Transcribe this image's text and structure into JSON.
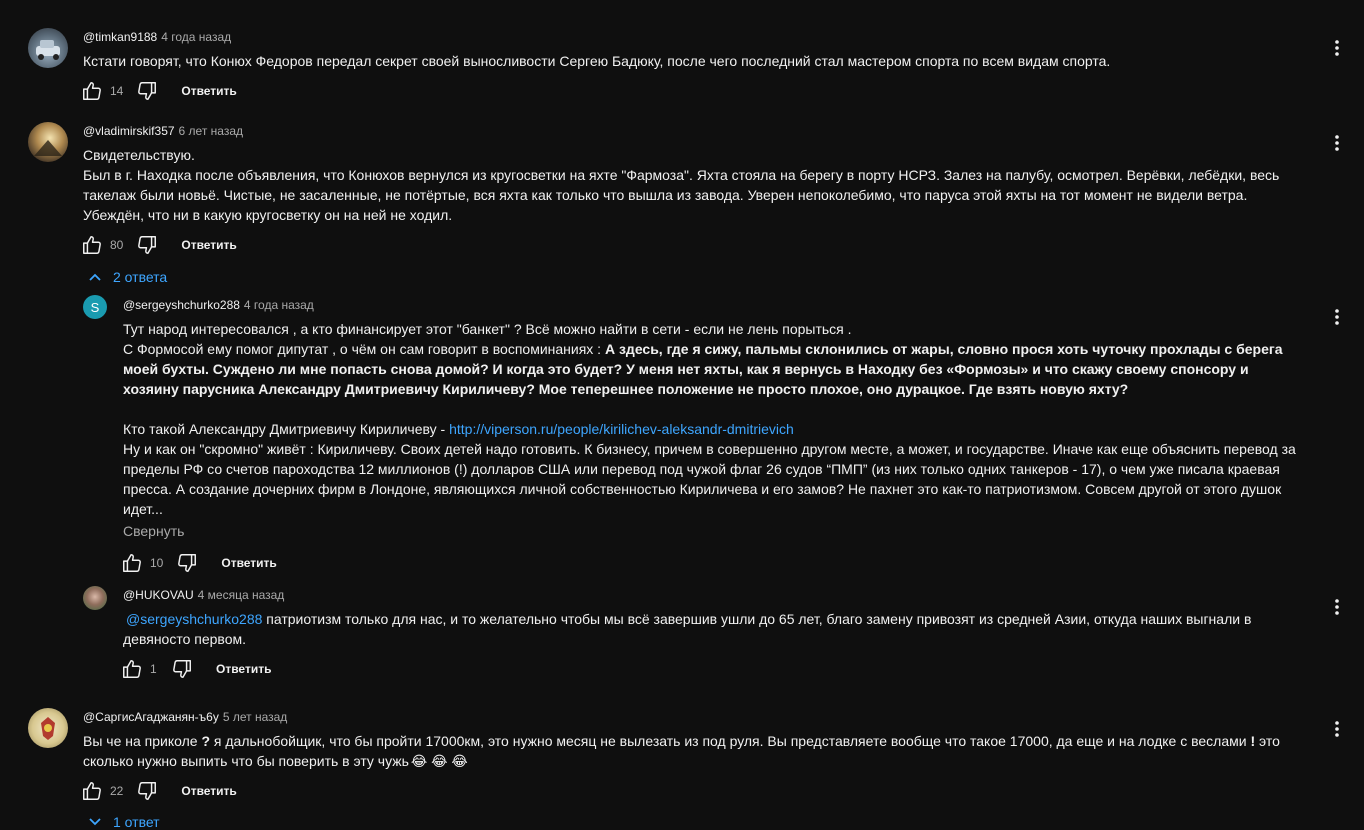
{
  "comments": [
    {
      "author": "@timkan9188",
      "time": "4 года назад",
      "text": "Кстати говорят, что Конюх Федоров передал секрет своей выносливости Сергею Бадюку, после чего последний стал мастером спорта по всем видам спорта.",
      "likes": "14",
      "reply_label": "Ответить"
    },
    {
      "author": "@vladimirskif357",
      "time": "6 лет назад",
      "text_lines": [
        "Свидетельствую.",
        "Был в г. Находка после объявления, что Конюхов вернулся из кругосветки на яхте \"Фармоза\". Яхта стояла на берегу в порту  НСРЗ. Залез на палубу, осмотрел. Верёвки, лебёдки, весь такелаж были новьё. Чистые, не засаленные, не потёртые, вся яхта как только что вышла из завода. Уверен непоколебимо, что паруса этой яхты на тот момент не видели ветра. Убеждён, что ни в какую кругосветку он на ней не ходил."
      ],
      "likes": "80",
      "reply_label": "Ответить",
      "replies_toggle": "2 ответа",
      "replies": [
        {
          "author": "@sergeyshchurko288",
          "time": "4 года назад",
          "avatar_letter": "S",
          "line1": "Тут народ интересовался , а кто финансирует этот \"банкет\" ? Всё можно найти в сети - если не лень порыться .",
          "line2_plain": "С Формосой ему помог дипутат , о чём он сам говорит в воспоминаниях : ",
          "line2_bold": "А здесь, где я сижу, пальмы склонились от жары, словно прося хоть чуточку прохлады с берега моей бухты. Суждено ли мне попасть снова домой? И когда это будет? У меня нет яхты, как я вернусь в Находку без «Формозы» и что скажу своему спонсору и хозяину парусника Александру Дмитриевичу Кириличеву? Мое теперешнее положение не просто плохое, оно дурацкое. Где взять новую яхту?",
          "line3_plain": "Кто такой Александру Дмитриевичу Кириличеву  - ",
          "line3_link": "http://viperson.ru/people/kirilichev-aleksandr-dmitrievich",
          "line4": "Ну и как он \"скромно\" живёт : Кириличеву. Своих детей надо готовить. К бизнесу, причем в совершенно другом месте, а может, и государстве. Иначе как еще объяснить перевод за пределы РФ со счетов пароходства 12 миллионов (!) долларов США или перевод под чужой флаг 26 судов “ПМП” (из них только одних танкеров - 17), о чем уже писала краевая пресса. А создание дочерних фирм в Лондоне, являющихся личной собственностью Кириличева и его замов? Не пахнет это как-то патриотизмом. Совсем другой от этого душок идет...",
          "collapse_label": "Свернуть",
          "likes": "10",
          "reply_label": "Ответить"
        },
        {
          "author": "@HUKOVAU",
          "time": "4 месяца назад",
          "mention": "@sergeyshchurko288",
          "text": " патриотизм только для нас, и то желательно чтобы мы всё завершив ушли до 65 лет, благо замену привозят из средней Азии, откуда наших выгнали в девяносто первом.",
          "likes": "1",
          "reply_label": "Ответить"
        }
      ]
    },
    {
      "author": "@СаргисАгаджанян-ъ6у",
      "time": "5 лет назад",
      "text_a": "Вы че на приколе ",
      "text_q": "?",
      "text_b": " я дальнобойщик, что бы пройти 17000км, это нужно месяц не вылезать из под руля. Вы представляете вообще что такое 17000, да еще и на лодке с веслами ",
      "text_e": "!",
      "text_c": " это сколько нужно выпить что бы поверить в эту чужь",
      "emoji": "😂 😂 😂",
      "likes": "22",
      "reply_label": "Ответить",
      "replies_toggle": "1 ответ"
    }
  ],
  "colors": {
    "bg": "#0f0f0f",
    "text": "#f1f1f1",
    "secondary": "#aaaaaa",
    "link": "#3ea6ff",
    "avatar_s": "#1a9bb0"
  }
}
